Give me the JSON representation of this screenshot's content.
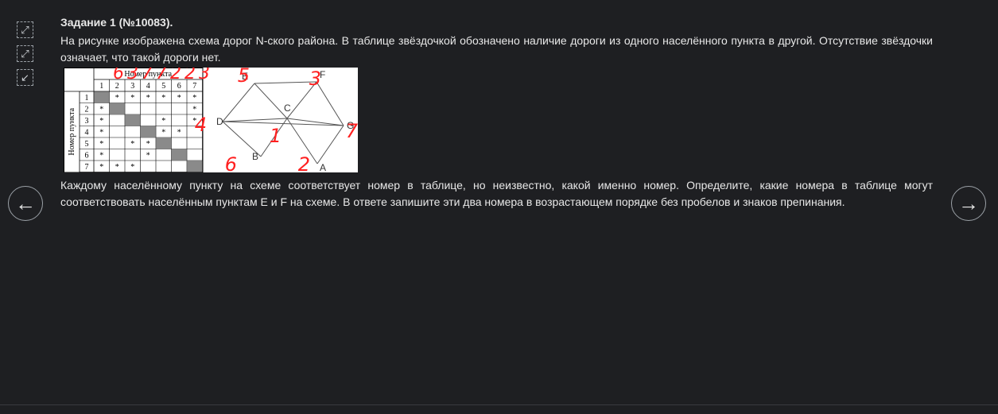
{
  "task": {
    "title": "Задание 1 (№10083).",
    "intro": "На рисунке изображена схема дорог N-ского района. В таблице звёздочкой обозначено наличие дороги из одного населённого пункта в другой. Отсутствие звёздочки означает, что такой дороги нет.",
    "question": "Каждому населённому пункту на схеме соответствует номер в таблице, но неизвестно, какой именно номер. Определите, какие номера в таблице могут соответствовать населённым пунктам E и F на схеме. В ответе запишите эти два номера в возрастающем порядке без пробелов и знаков препинания."
  },
  "toolbar": {
    "icons": [
      "expand-icon",
      "fullscreen-icon",
      "collapse-icon"
    ]
  },
  "nav": {
    "prev_symbol": "←",
    "next_symbol": "→"
  },
  "table": {
    "col_header": "Номер пункта",
    "row_header": "Номер пункта",
    "numbers": [
      "1",
      "2",
      "3",
      "4",
      "5",
      "6",
      "7"
    ],
    "cells": [
      [
        "",
        "*",
        "*",
        "*",
        "*",
        "*",
        "*"
      ],
      [
        "*",
        "",
        "",
        "",
        "",
        "",
        "*"
      ],
      [
        "*",
        "",
        "",
        "",
        "*",
        "",
        "*"
      ],
      [
        "*",
        "",
        "",
        "",
        "*",
        "*",
        ""
      ],
      [
        "*",
        "",
        "*",
        "*",
        "",
        "",
        ""
      ],
      [
        "*",
        "",
        "",
        "*",
        "",
        "",
        ""
      ],
      [
        "*",
        "*",
        "*",
        "",
        "",
        "",
        ""
      ]
    ]
  },
  "graph": {
    "nodes": [
      "A",
      "B",
      "C",
      "D",
      "E",
      "F",
      "G"
    ],
    "edges": [
      [
        "E",
        "F"
      ],
      [
        "E",
        "D"
      ],
      [
        "E",
        "C"
      ],
      [
        "F",
        "C"
      ],
      [
        "F",
        "G"
      ],
      [
        "D",
        "C"
      ],
      [
        "D",
        "G"
      ],
      [
        "C",
        "G"
      ],
      [
        "C",
        "B"
      ],
      [
        "C",
        "A"
      ],
      [
        "B",
        "D"
      ],
      [
        "A",
        "G"
      ]
    ]
  },
  "handwritten": {
    "color": "#ff2020",
    "header_digits": "6377223",
    "E": "5",
    "F": "3",
    "D": "4",
    "G": "7",
    "C": "1",
    "B": "6",
    "A": "2"
  },
  "colors": {
    "background": "#1e1f22",
    "text": "#e8e8e8",
    "figure_bg": "#ffffff",
    "diagonal_cell": "#8a8a8a"
  }
}
